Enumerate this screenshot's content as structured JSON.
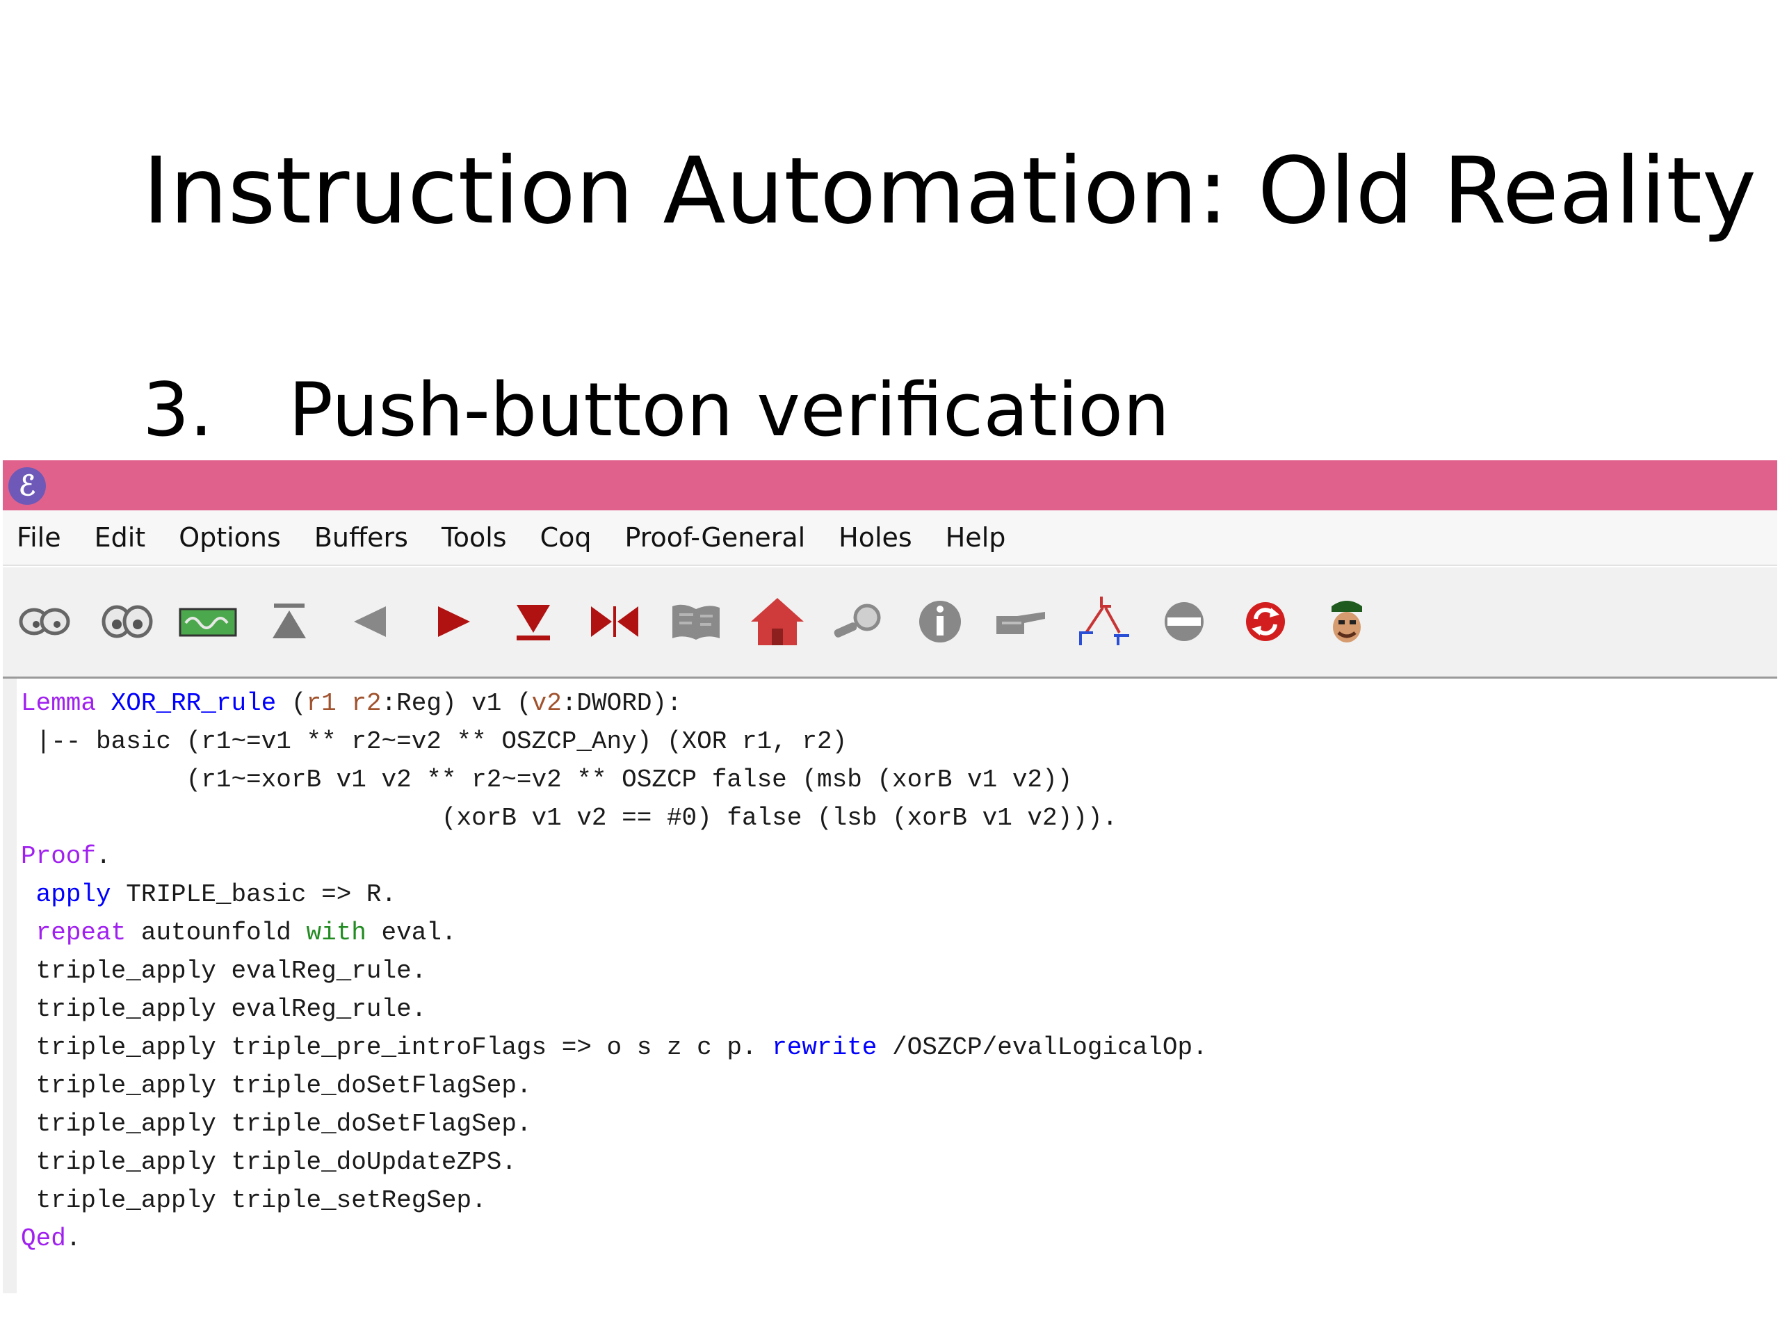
{
  "slide": {
    "title": "Instruction Automation: Old Reality",
    "point_number": "3.",
    "point_text": "Push-button verification"
  },
  "window": {
    "app_icon": "emacs-icon",
    "titlebar_color": "#e0628c",
    "menu": [
      "File",
      "Edit",
      "Options",
      "Buffers",
      "Tools",
      "Coq",
      "Proof-General",
      "Holes",
      "Help"
    ],
    "toolbar": [
      "state-icon",
      "context-icon",
      "goal-icon",
      "retract-icon",
      "undo-icon",
      "next-icon",
      "use-icon",
      "goto-icon",
      "qed-icon",
      "home-icon",
      "find-icon",
      "info-icon",
      "command-icon",
      "prooftree-icon",
      "interrupt-icon",
      "restart-icon",
      "help-icon"
    ]
  },
  "code": {
    "line1": {
      "lemma_kw": "Lemma",
      "name": "XOR_RR_rule",
      "p1": "(",
      "r1": "r1",
      "sp": " ",
      "r2": "r2",
      "reg": ":Reg) v1 (",
      "v2": "v2",
      "dword": ":DWORD):"
    },
    "line2": " |-- basic (r1~=v1 ** r2~=v2 ** OSZCP_Any) (XOR r1, r2)",
    "line3": "           (r1~=xorB v1 v2 ** r2~=v2 ** OSZCP false (msb (xorB v1 v2))",
    "line4": "                            (xorB v1 v2 == #0) false (lsb (xorB v1 v2))).",
    "line5": {
      "kw": "Proof",
      "rest": "."
    },
    "line6": {
      "indent": " ",
      "kw": "apply",
      "rest": " TRIPLE_basic => R."
    },
    "line7": {
      "indent": " ",
      "kw": "repeat",
      "mid": " autounfold ",
      "with": "with",
      "rest": " eval."
    },
    "line8": " triple_apply evalReg_rule.",
    "line9": " triple_apply evalReg_rule.",
    "line10": {
      "start": " triple_apply triple_pre_introFlags => o s z c p. ",
      "kw": "rewrite",
      "rest": " /OSZCP/evalLogicalOp."
    },
    "line11": " triple_apply triple_doSetFlagSep.",
    "line12": " triple_apply triple_doSetFlagSep.",
    "line13": " triple_apply triple_doUpdateZPS.",
    "line14": " triple_apply triple_setRegSep.",
    "line15": {
      "kw": "Qed",
      "rest": "."
    }
  }
}
